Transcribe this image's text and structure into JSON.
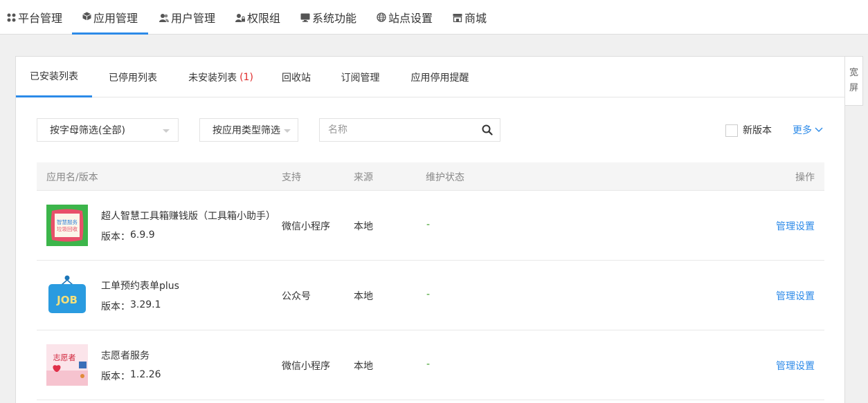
{
  "topnav": {
    "items": [
      {
        "label": "平台管理",
        "icon": "grid-icon"
      },
      {
        "label": "应用管理",
        "icon": "cube-icon",
        "active": true
      },
      {
        "label": "用户管理",
        "icon": "users-icon"
      },
      {
        "label": "权限组",
        "icon": "user-lock-icon"
      },
      {
        "label": "系统功能",
        "icon": "monitor-icon"
      },
      {
        "label": "站点设置",
        "icon": "globe-icon"
      },
      {
        "label": "商城",
        "icon": "store-icon"
      }
    ]
  },
  "tabs": {
    "installed": "已安装列表",
    "disabled": "已停用列表",
    "not_installed": "未安装列表",
    "not_installed_badge": "(1)",
    "recycle": "回收站",
    "subscription": "订阅管理",
    "stop_reminder": "应用停用提醒"
  },
  "side_button": {
    "line1": "宽",
    "line2": "屏"
  },
  "filters": {
    "by_letter": "按字母筛选(全部)",
    "by_type": "按应用类型筛选",
    "search_placeholder": "名称",
    "new_version": "新版本",
    "more": "更多"
  },
  "table": {
    "headers": {
      "name": "应用名/版本",
      "support": "支持",
      "source": "来源",
      "maintenance": "维护状态",
      "action": "操作"
    },
    "rows": [
      {
        "name": "超人智慧工具箱赚钱版（工具箱小助手）",
        "version_label": "版本：",
        "version": "6.9.9",
        "support": "微信小程序",
        "source": "本地",
        "status": "-",
        "action": "管理设置",
        "thumb_text1": "智慧服务",
        "thumb_text2": "垃圾回收"
      },
      {
        "name": "工单预约表单plus",
        "version_label": "版本：",
        "version": "3.29.1",
        "support": "公众号",
        "source": "本地",
        "status": "-",
        "action": "管理设置",
        "thumb_text1": "JOB"
      },
      {
        "name": "志愿者服务",
        "version_label": "版本：",
        "version": "1.2.26",
        "support": "微信小程序",
        "source": "本地",
        "status": "-",
        "action": "管理设置",
        "thumb_text1": "志愿者"
      }
    ]
  },
  "colors": {
    "accent": "#2c8ae8",
    "status_green": "#3a9d23",
    "badge_red": "#e02b2b"
  }
}
